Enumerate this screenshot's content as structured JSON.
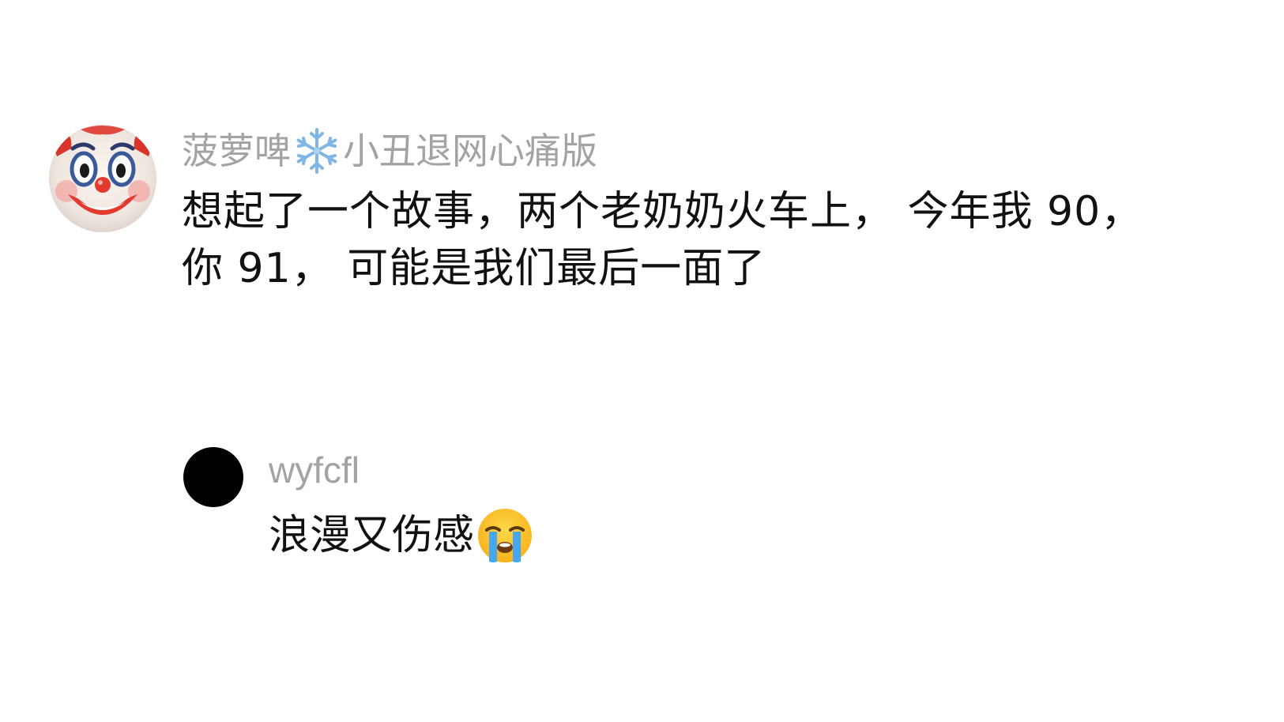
{
  "comment": {
    "username_part1": "菠萝啤",
    "username_emoji": "snowflake-icon",
    "username_part2": "小丑退网心痛版",
    "text": "想起了一个故事，两个老奶奶火车上， 今年我 90，你 91， 可能是我们最后一面了",
    "avatar": "clown-face-icon"
  },
  "reply": {
    "username": "wyfcfl",
    "text": "浪漫又伤感",
    "emoji": "loudly-crying-face-icon",
    "avatar": "black-circle-avatar"
  }
}
